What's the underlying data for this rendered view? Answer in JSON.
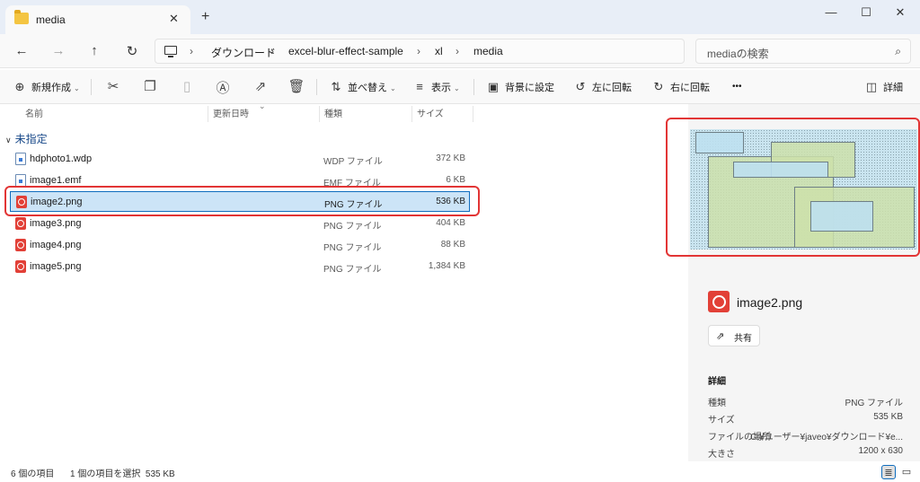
{
  "window": {
    "tab_title": "media",
    "tab_close": "✕",
    "new_tab": "+",
    "minimize": "—",
    "maximize": "☐",
    "close": "✕"
  },
  "address": {
    "breadcrumbs": [
      "ダウンロード",
      "excel-blur-effect-sample",
      "xl",
      "media"
    ],
    "search_placeholder": "mediaの検索"
  },
  "commands": {
    "new": "新規作成",
    "sort": "並べ替え",
    "view": "表示",
    "set_background": "背景に設定",
    "rotate_left": "左に回転",
    "rotate_right": "右に回転",
    "more": "•••",
    "details": "詳細"
  },
  "columns": {
    "name": "名前",
    "modified": "更新日時",
    "type": "種類",
    "size": "サイズ"
  },
  "group_label": "未指定",
  "files": [
    {
      "name": "hdphoto1.wdp",
      "type": "WDP ファイル",
      "size": "372 KB",
      "icon": "document-icon"
    },
    {
      "name": "image1.emf",
      "type": "EMF ファイル",
      "size": "6 KB",
      "icon": "document-icon"
    },
    {
      "name": "image2.png",
      "type": "PNG ファイル",
      "size": "536 KB",
      "icon": "png-icon",
      "selected": true
    },
    {
      "name": "image3.png",
      "type": "PNG ファイル",
      "size": "404 KB",
      "icon": "png-icon"
    },
    {
      "name": "image4.png",
      "type": "PNG ファイル",
      "size": "88 KB",
      "icon": "png-icon"
    },
    {
      "name": "image5.png",
      "type": "PNG ファイル",
      "size": "1,384 KB",
      "icon": "png-icon"
    }
  ],
  "preview": {
    "file_name": "image2.png",
    "share_label": "共有",
    "details_heading": "詳細",
    "details": [
      {
        "key": "種類",
        "value": "PNG ファイル"
      },
      {
        "key": "サイズ",
        "value": "535 KB"
      },
      {
        "key": "ファイルの場所",
        "value": "C:¥ユーザー¥javeo¥ダウンロード¥e..."
      },
      {
        "key": "大きさ",
        "value": "1200 x 630"
      }
    ]
  },
  "status": {
    "item_count": "6 個の項目",
    "selection": "1 個の項目を選択  535 KB"
  },
  "colors": {
    "highlight": "#e23535",
    "selection_bg": "#cce4f7",
    "selection_border": "#0f6cbd",
    "png_icon": "#e24037"
  }
}
